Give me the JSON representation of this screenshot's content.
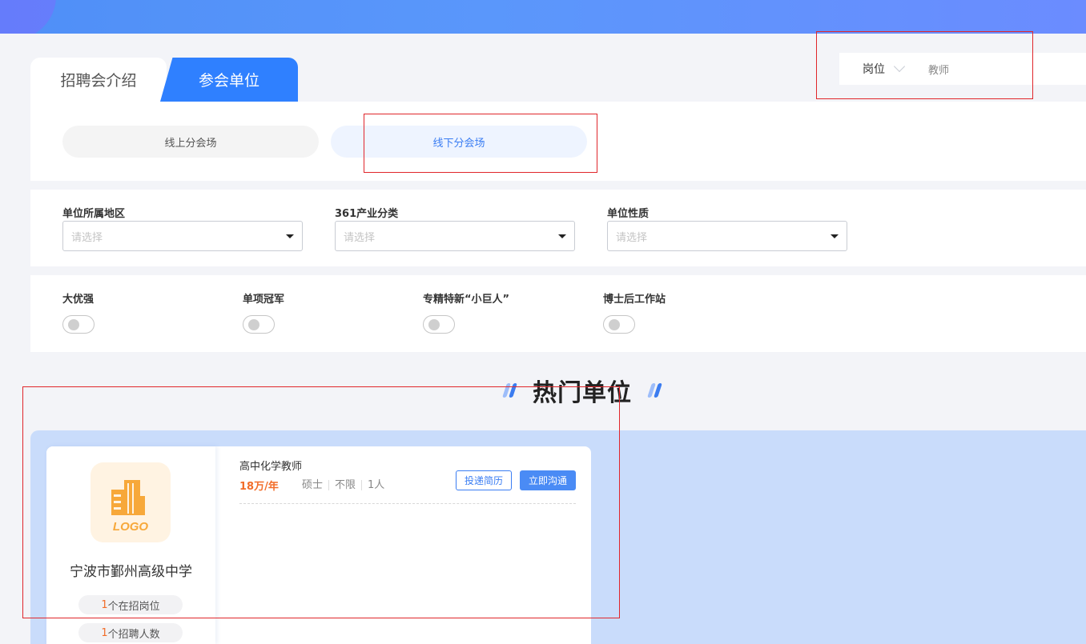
{
  "tabs": {
    "intro": "招聘会介绍",
    "units": "参会单位"
  },
  "search": {
    "category": "岗位",
    "keyword": "教师"
  },
  "venues": {
    "online": "线上分会场",
    "offline": "线下分会场"
  },
  "filters": [
    {
      "label": "单位所属地区",
      "placeholder": "请选择"
    },
    {
      "label": "361产业分类",
      "placeholder": "请选择"
    },
    {
      "label": "单位性质",
      "placeholder": "请选择"
    }
  ],
  "toggles": [
    {
      "label": "大优强",
      "on": false
    },
    {
      "label": "单项冠军",
      "on": false
    },
    {
      "label": "专精特新“小巨人”",
      "on": false
    },
    {
      "label": "博士后工作站",
      "on": false
    }
  ],
  "hot_section": {
    "title": "热门单位"
  },
  "unit_card": {
    "logo_text": "LOGO",
    "name": "宁波市鄞州高级中学",
    "open_positions_count": "1",
    "open_positions_label": "个在招岗位",
    "hiring_count": "1",
    "hiring_label": "个招聘人数",
    "job": {
      "title": "高中化学教师",
      "salary": "18万/年",
      "degree": "硕士",
      "experience": "不限",
      "headcount": "1人",
      "apply_label": "投递简历",
      "chat_label": "立即沟通"
    }
  },
  "colors": {
    "accent": "#2f80ff",
    "salary": "#f26d2a",
    "highlight_box": "#e0262b",
    "hot_area_bg": "#c9dcfb"
  }
}
